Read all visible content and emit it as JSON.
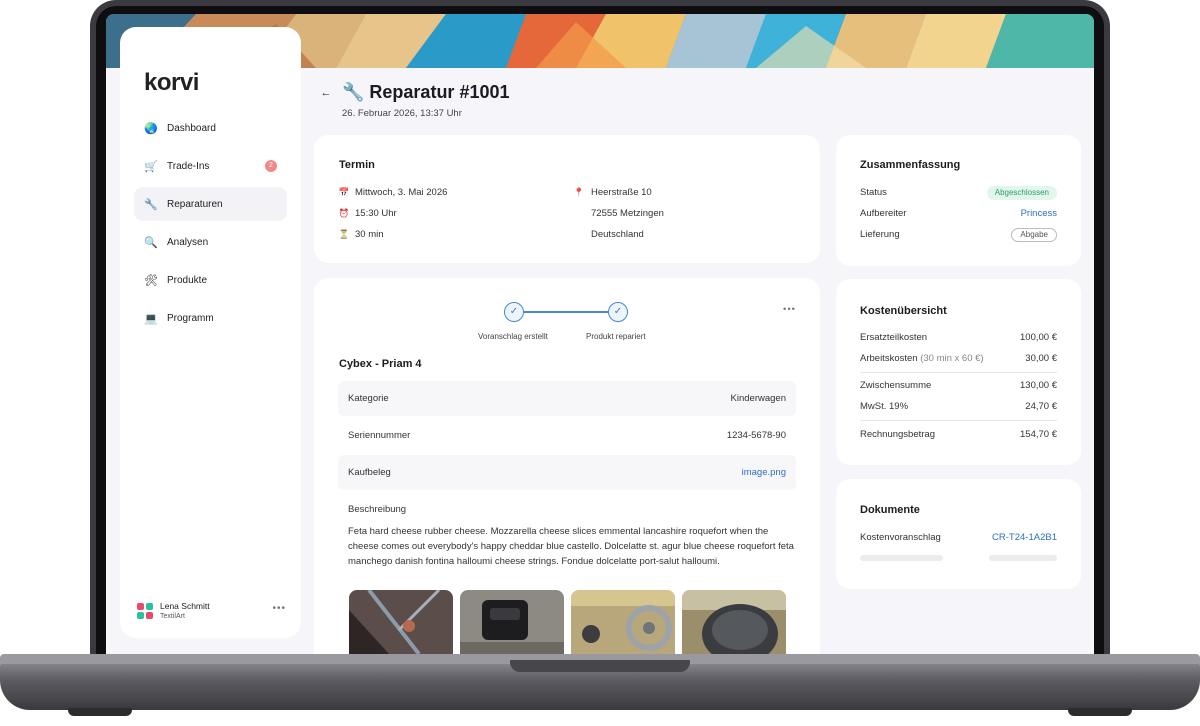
{
  "app": {
    "logo": "korvi"
  },
  "sidebar": {
    "items": [
      {
        "label": "Dashboard",
        "icon": "globe-icon",
        "glyph": "🌏"
      },
      {
        "label": "Trade-Ins",
        "icon": "cart-icon",
        "glyph": "🛒",
        "badge": "2"
      },
      {
        "label": "Reparaturen",
        "icon": "wrench-icon",
        "glyph": "🔧",
        "active": true
      },
      {
        "label": "Analysen",
        "icon": "magnifier-icon",
        "glyph": "🔍"
      },
      {
        "label": "Produkte",
        "icon": "tools-icon",
        "glyph": "🛠"
      },
      {
        "label": "Programm",
        "icon": "laptop-icon",
        "glyph": "💻"
      }
    ],
    "user": {
      "name": "Lena Schmitt",
      "company": "TextilArt",
      "more": "•••"
    }
  },
  "header": {
    "back": "←",
    "title": "🔧 Reparatur #1001",
    "date": "26. Februar 2026, 13:37 Uhr"
  },
  "termin": {
    "title": "Termin",
    "date": "Mittwoch, 3. Mai 2026",
    "time": "15:30 Uhr",
    "duration": "30 min",
    "street": "Heerstraße 10",
    "city": "72555 Metzingen",
    "country": "Deutschland",
    "icons": {
      "date": "📅",
      "time": "⏰",
      "duration": "⏳",
      "location": "📍"
    }
  },
  "progress": {
    "steps": [
      {
        "label": "Voranschlag erstellt",
        "done": true
      },
      {
        "label": "Produkt repariert",
        "done": true
      }
    ],
    "check": "✓",
    "more": "•••"
  },
  "product": {
    "name": "Cybex - Priam 4",
    "rows": [
      {
        "key": "Kategorie",
        "value": "Kinderwagen"
      },
      {
        "key": "Seriennummer",
        "value": "1234-5678-90"
      },
      {
        "key": "Kaufbeleg",
        "value": "image.png",
        "link": true
      }
    ],
    "desc_label": "Beschreibung",
    "description": "Feta hard cheese rubber cheese. Mozzarella cheese slices emmental lancashire roquefort when the cheese comes out everybody's happy cheddar blue castello. Dolcelatte st. agur blue cheese roquefort feta manchego danish fontina halloumi cheese strings. Fondue dolcelatte port-salut halloumi."
  },
  "summary": {
    "title": "Zusammenfassung",
    "status_label": "Status",
    "status_value": "Abgeschlossen",
    "refurbisher_label": "Aufbereiter",
    "refurbisher_value": "Princess",
    "delivery_label": "Lieferung",
    "delivery_value": "Abgabe"
  },
  "costs": {
    "title": "Kostenübersicht",
    "parts_label": "Ersatzteilkosten",
    "parts_value": "100,00 €",
    "labor_label": "Arbeitskosten",
    "labor_note": "(30 min x 60 €)",
    "labor_value": "30,00 €",
    "subtotal_label": "Zwischensumme",
    "subtotal_value": "130,00 €",
    "vat_label": "MwSt. 19%",
    "vat_value": "24,70 €",
    "total_label": "Rechnungsbetrag",
    "total_value": "154,70 €"
  },
  "documents": {
    "title": "Dokumente",
    "label": "Kostenvoranschlag",
    "value": "CR-T24-1A2B1"
  },
  "colors": {
    "accent": "#2a6fc8",
    "success": "#2b9b6c",
    "badge": "#f08a8a"
  }
}
